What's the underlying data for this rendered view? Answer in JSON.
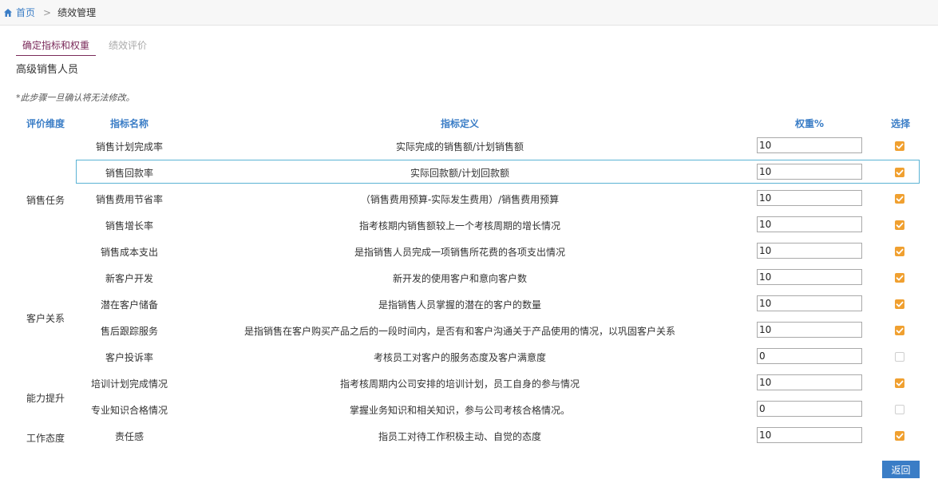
{
  "breadcrumb": {
    "home": "首页",
    "separator": ">",
    "current": "绩效管理"
  },
  "tabs": [
    {
      "label": "确定指标和权重",
      "active": true
    },
    {
      "label": "绩效评价",
      "active": false
    }
  ],
  "role_title": "高级销售人员",
  "notice": "*此步骤一旦确认将无法修改。",
  "table": {
    "headers": {
      "dimension": "评价维度",
      "name": "指标名称",
      "definition": "指标定义",
      "weight": "权重%",
      "select": "选择"
    },
    "dimensions": [
      {
        "label": "销售任务"
      },
      {
        "label": "客户关系"
      },
      {
        "label": "能力提升"
      },
      {
        "label": "工作态度"
      }
    ],
    "rows": [
      {
        "name": "销售计划完成率",
        "definition": "实际完成的销售额/计划销售额",
        "weight": "10",
        "selected": true
      },
      {
        "name": "销售回款率",
        "definition": "实际回款额/计划回款额",
        "weight": "10",
        "selected": true
      },
      {
        "name": "销售费用节省率",
        "definition": "（销售费用预算-实际发生费用）/销售费用预算",
        "weight": "10",
        "selected": true
      },
      {
        "name": "销售增长率",
        "definition": "指考核期内销售额较上一个考核周期的增长情况",
        "weight": "10",
        "selected": true
      },
      {
        "name": "销售成本支出",
        "definition": "是指销售人员完成一项销售所花费的各项支出情况",
        "weight": "10",
        "selected": true
      },
      {
        "name": "新客户开发",
        "definition": "新开发的使用客户和意向客户数",
        "weight": "10",
        "selected": true
      },
      {
        "name": "潜在客户储备",
        "definition": "是指销售人员掌握的潜在的客户的数量",
        "weight": "10",
        "selected": true
      },
      {
        "name": "售后跟踪服务",
        "definition": "是指销售在客户购买产品之后的一段时间内，是否有和客户沟通关于产品使用的情况，以巩固客户关系",
        "weight": "10",
        "selected": true
      },
      {
        "name": "客户投诉率",
        "definition": "考核员工对客户的服务态度及客户满意度",
        "weight": "0",
        "selected": false
      },
      {
        "name": "培训计划完成情况",
        "definition": "指考核周期内公司安排的培训计划，员工自身的参与情况",
        "weight": "10",
        "selected": true
      },
      {
        "name": "专业知识合格情况",
        "definition": "掌握业务知识和相关知识，参与公司考核合格情况。",
        "weight": "0",
        "selected": false
      },
      {
        "name": "责任感",
        "definition": "指员工对待工作积极主动、自觉的态度",
        "weight": "10",
        "selected": true
      }
    ]
  },
  "return_button": "返回",
  "colors": {
    "accent": "#3a7dc6",
    "check": "#f0a030",
    "tab_active": "#7a2a5a",
    "highlight_border": "#5bb3d4"
  }
}
